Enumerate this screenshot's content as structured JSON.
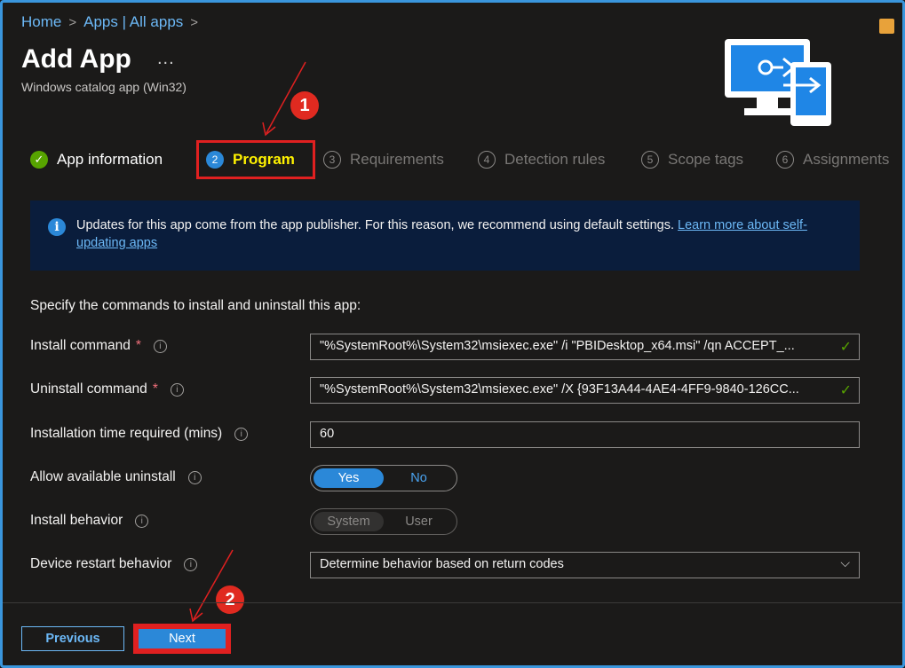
{
  "breadcrumb": {
    "home": "Home",
    "apps": "Apps | All apps"
  },
  "page": {
    "title": "Add App",
    "more": "...",
    "subtitle": "Windows catalog app (Win32)"
  },
  "callouts": {
    "one": "1",
    "two": "2"
  },
  "steps": [
    {
      "num": "✓",
      "label": "App information",
      "state": "done"
    },
    {
      "num": "2",
      "label": "Program",
      "state": "active"
    },
    {
      "num": "3",
      "label": "Requirements",
      "state": "pending"
    },
    {
      "num": "4",
      "label": "Detection rules",
      "state": "pending"
    },
    {
      "num": "5",
      "label": "Scope tags",
      "state": "pending"
    },
    {
      "num": "6",
      "label": "Assignments",
      "state": "pending"
    }
  ],
  "info": {
    "icon": "i",
    "text": "Updates for this app come from the app publisher. For this reason, we recommend using default settings. ",
    "link": "Learn more about self-updating apps"
  },
  "instructions": "Specify the commands to install and uninstall this app:",
  "form": {
    "install_label": "Install command",
    "install_value": "\"%SystemRoot%\\System32\\msiexec.exe\" /i \"PBIDesktop_x64.msi\" /qn ACCEPT_...",
    "uninstall_label": "Uninstall command",
    "uninstall_value": "\"%SystemRoot%\\System32\\msiexec.exe\" /X {93F13A44-4AE4-4FF9-9840-126CC...",
    "time_label": "Installation time required (mins)",
    "time_value": "60",
    "allow_label": "Allow available uninstall",
    "allow_yes": "Yes",
    "allow_no": "No",
    "behavior_label": "Install behavior",
    "behavior_system": "System",
    "behavior_user": "User",
    "restart_label": "Device restart behavior",
    "restart_value": "Determine behavior based on return codes",
    "required_mark": "*",
    "tooltip_glyph": "i",
    "valid_mark": "✓",
    "dropdown_glyph": "⌵"
  },
  "footer": {
    "previous": "Previous",
    "next": "Next"
  },
  "colors": {
    "accent": "#2b88d8",
    "highlight": "#e02020",
    "success": "#57a300",
    "link": "#6cb8f6"
  }
}
